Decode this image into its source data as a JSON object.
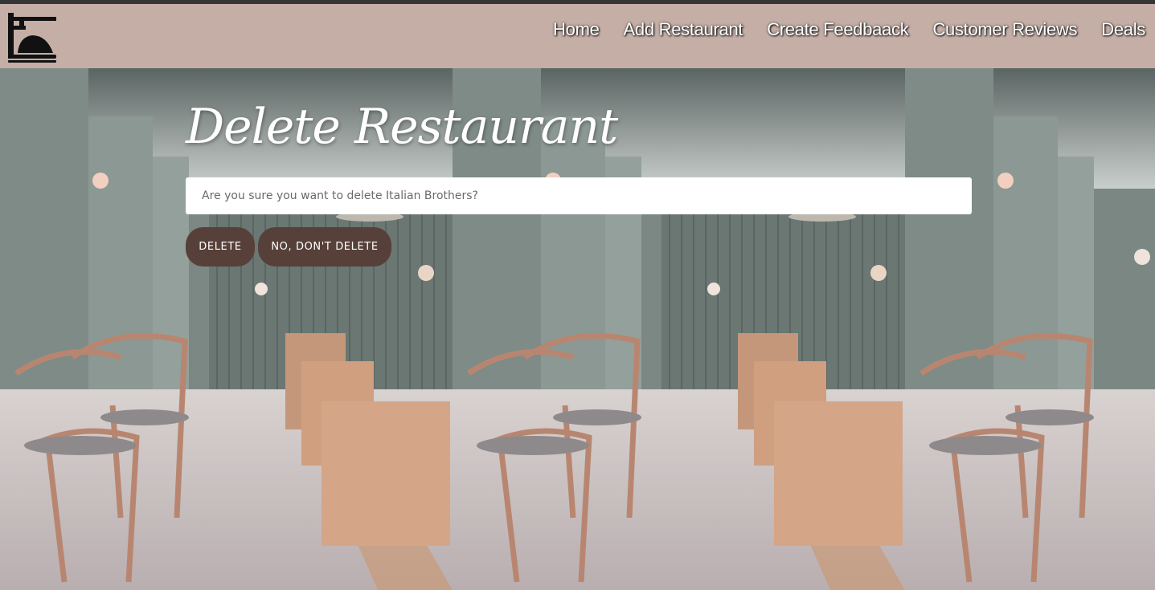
{
  "nav": {
    "logo_icon": "restaurant-logo-icon",
    "links": [
      {
        "label": "Home"
      },
      {
        "label": "Add Restaurant"
      },
      {
        "label": "Create Feedbaack"
      },
      {
        "label": "Customer Reviews"
      },
      {
        "label": "Deals"
      }
    ]
  },
  "page": {
    "title": "Delete Restaurant",
    "confirm_message": "Are you sure you want to delete Italian Brothers?"
  },
  "buttons": {
    "delete_label": "DELETE",
    "cancel_label": "NO, DON'T DELETE"
  },
  "colors": {
    "navbar_bg": "#c4aea6",
    "button_bg": "#57403a",
    "top_strip": "#353535"
  },
  "background_image": "restaurant-interior-photo (tiled)"
}
